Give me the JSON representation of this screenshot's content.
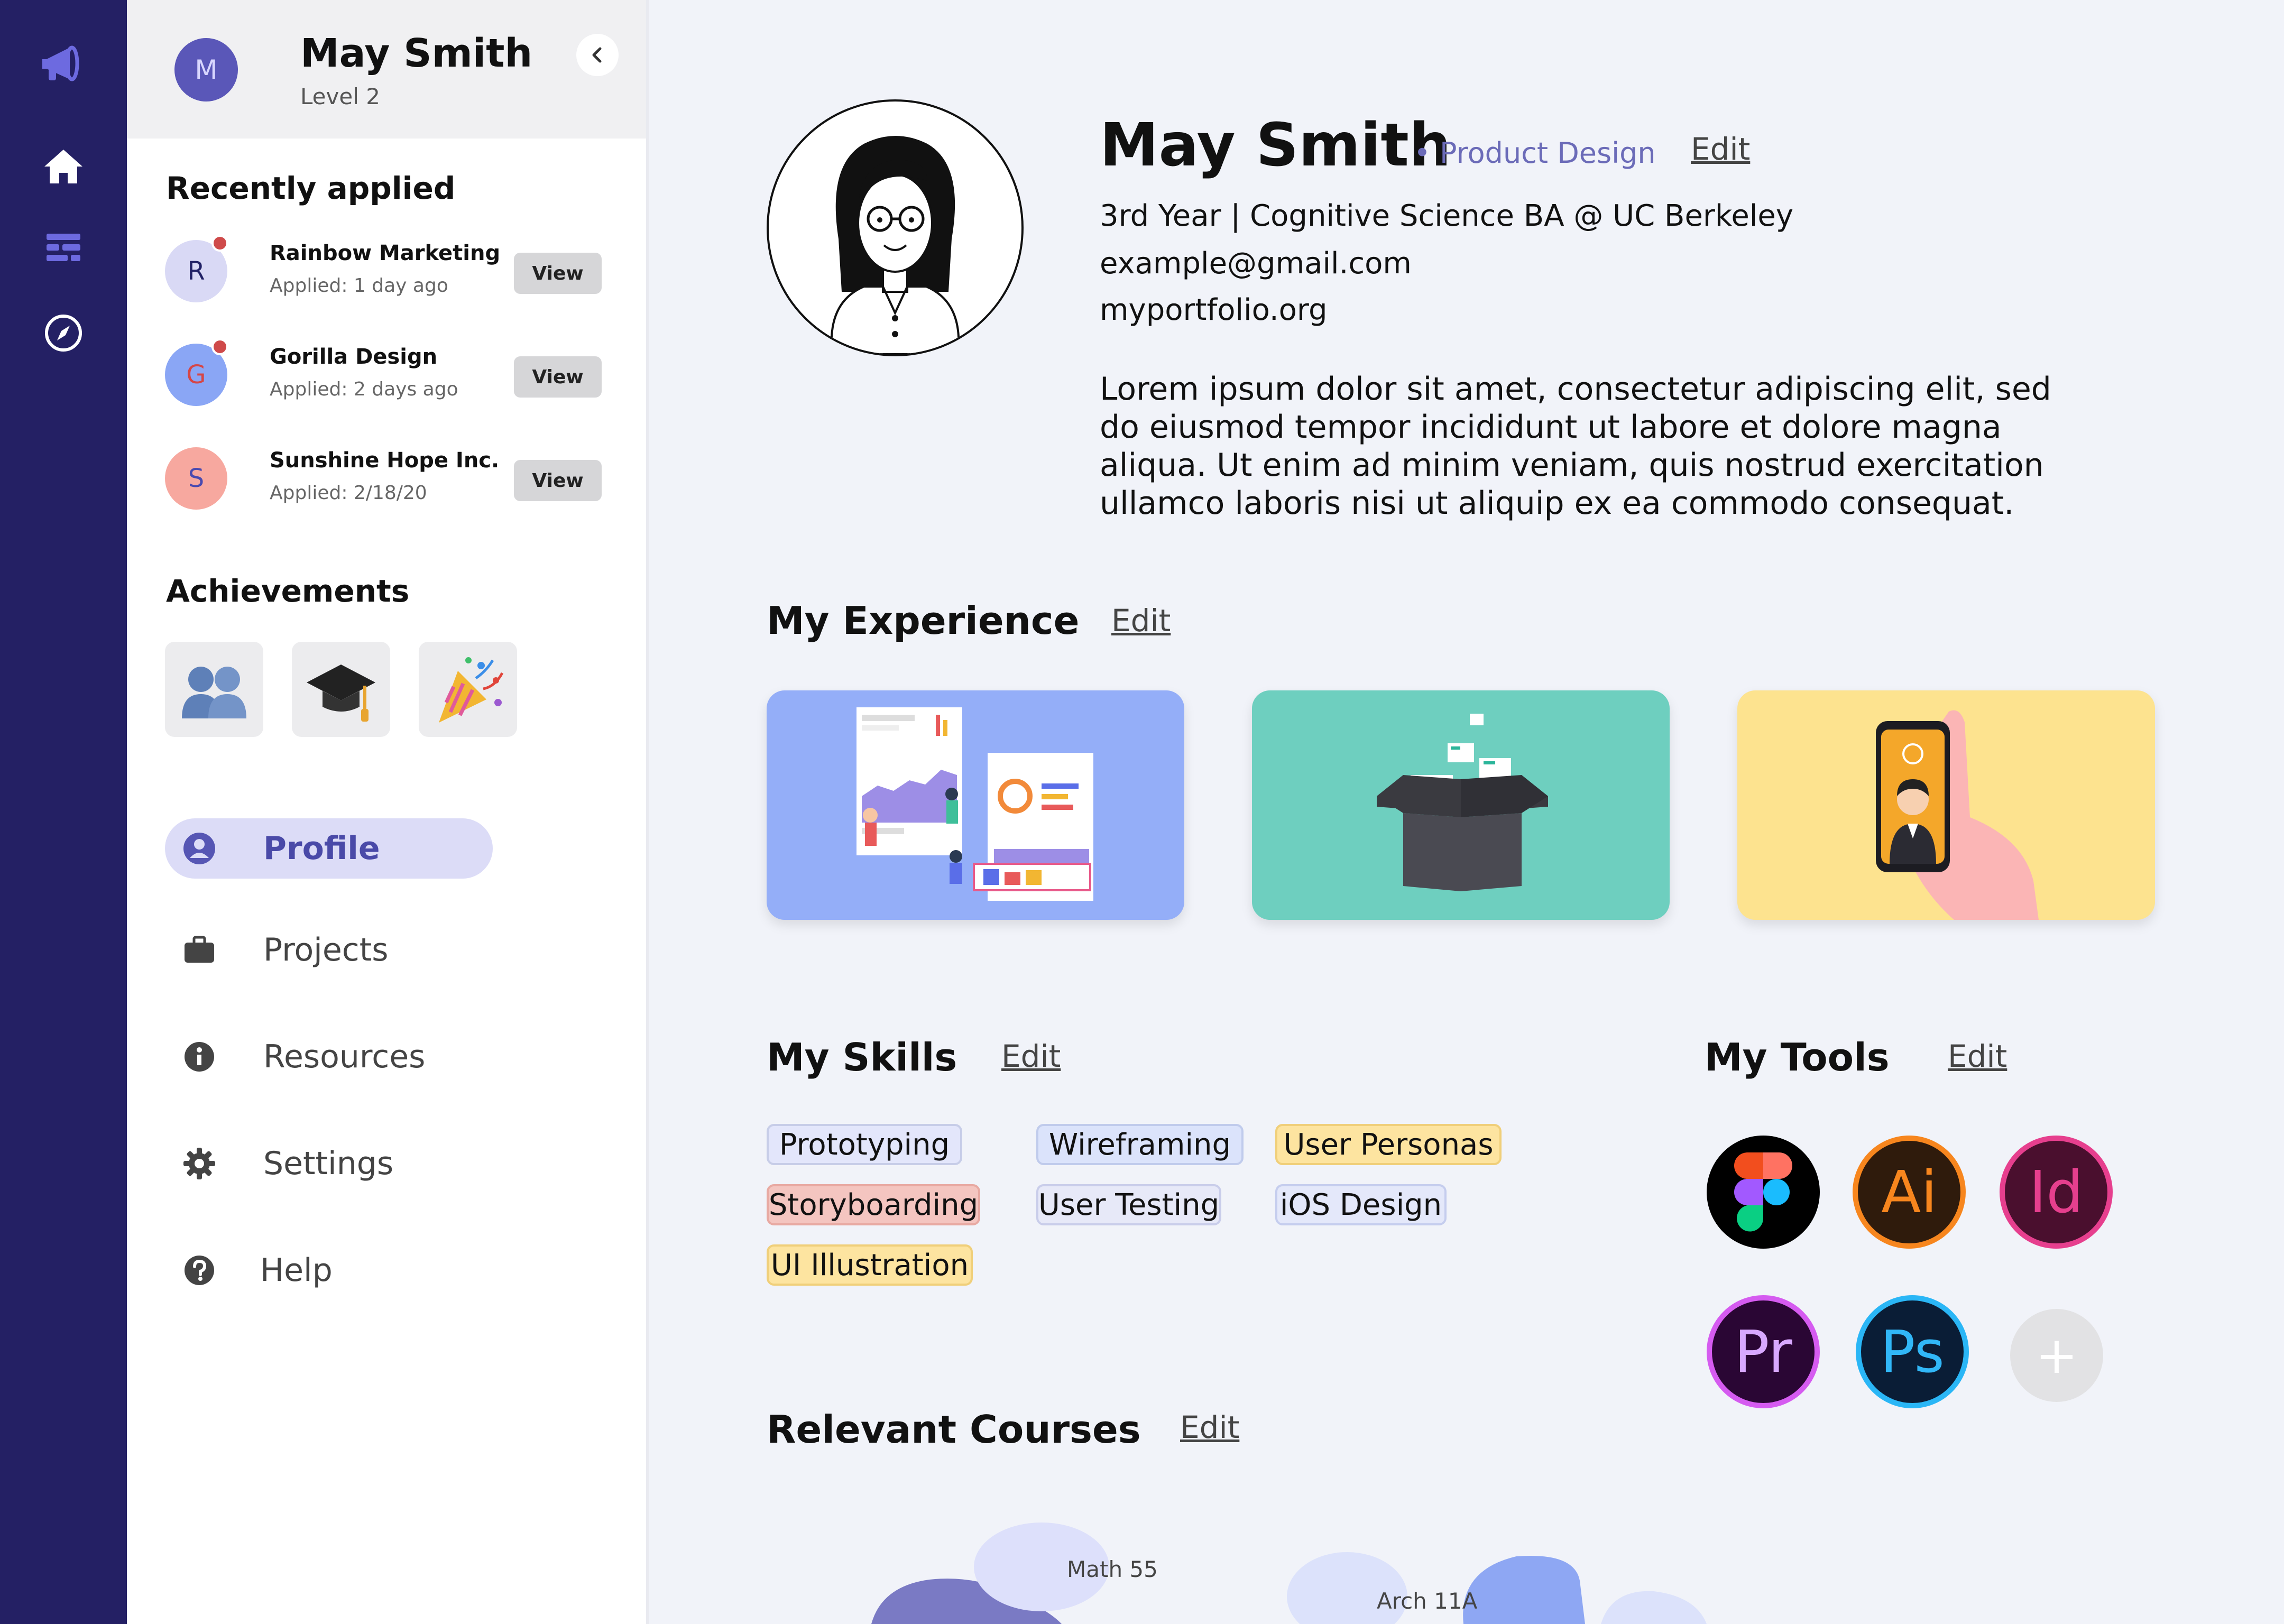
{
  "user": {
    "initial": "M",
    "name": "May Smith",
    "level": "Level 2"
  },
  "rail": {
    "icons": [
      "megaphone-icon",
      "home-icon",
      "dashboard-icon",
      "compass-icon"
    ]
  },
  "recently_applied": {
    "title": "Recently applied",
    "items": [
      {
        "initial": "R",
        "company": "Rainbow Marketing",
        "applied": "Applied: 1 day ago",
        "view": "View",
        "avatar_bg": "#d9d9f5",
        "avatar_fg": "#222266",
        "unread": true
      },
      {
        "initial": "G",
        "company": "Gorilla Design",
        "applied": "Applied: 2 days ago",
        "view": "View",
        "avatar_bg": "#8aa6f5",
        "avatar_fg": "#d64545",
        "unread": true
      },
      {
        "initial": "S",
        "company": "Sunshine Hope Inc.",
        "applied": "Applied: 2/18/20",
        "view": "View",
        "avatar_bg": "#f7a89f",
        "avatar_fg": "#4a4ab0",
        "unread": false
      }
    ]
  },
  "achievements": {
    "title": "Achievements",
    "items": [
      "people-badge-icon",
      "graduation-cap-icon",
      "party-popper-icon"
    ]
  },
  "nav": {
    "items": [
      {
        "label": "Profile",
        "icon": "user-circle-icon",
        "active": true
      },
      {
        "label": "Projects",
        "icon": "briefcase-icon",
        "active": false
      },
      {
        "label": "Resources",
        "icon": "info-icon",
        "active": false
      },
      {
        "label": "Settings",
        "icon": "gear-icon",
        "active": false
      },
      {
        "label": "Help",
        "icon": "help-icon",
        "active": false
      }
    ]
  },
  "profile": {
    "name": "May Smith",
    "department": "• Product Design",
    "edit": "Edit",
    "education": "3rd Year | Cognitive Science BA @ UC Berkeley",
    "email": "example@gmail.com",
    "website": "myportfolio.org",
    "bio": "Lorem ipsum dolor sit amet, consectetur adipiscing elit, sed do eiusmod tempor incididunt ut labore et dolore magna aliqua. Ut enim ad minim veniam, quis nostrud exercitation ullamco laboris nisi ut aliquip ex ea commodo consequat."
  },
  "experience": {
    "title": "My Experience",
    "edit": "Edit",
    "cards": [
      {
        "icon": "analytics-illustration-icon",
        "bg": "#94aef8"
      },
      {
        "icon": "open-box-illustration-icon",
        "bg": "#6ecfbf"
      },
      {
        "icon": "phone-selfie-illustration-icon",
        "bg": "#fde38f"
      }
    ]
  },
  "skills": {
    "title": "My Skills",
    "edit": "Edit",
    "items": [
      {
        "label": "Prototyping",
        "bg": "#e3e6fb",
        "border": "#c7cde8"
      },
      {
        "label": "Wireframing",
        "bg": "#dbe3fb",
        "border": "#c0cbec"
      },
      {
        "label": "User Personas",
        "bg": "#fde4a0",
        "border": "#f0cf7a"
      },
      {
        "label": "Storyboarding",
        "bg": "#f4c5c0",
        "border": "#e8a9a2"
      },
      {
        "label": "User Testing",
        "bg": "#e7e9f8",
        "border": "#c9cdea"
      },
      {
        "label": "iOS Design",
        "bg": "#e4e8fa",
        "border": "#c5cdee"
      },
      {
        "label": "UI Illustration",
        "bg": "#fde4a0",
        "border": "#f0cf7a"
      }
    ]
  },
  "tools": {
    "title": "My Tools",
    "edit": "Edit",
    "items": [
      {
        "icon": "figma-icon",
        "label": "",
        "bg": "#000000",
        "ring": "#000000",
        "fg": "#ffffff"
      },
      {
        "icon": "illustrator-icon",
        "label": "Ai",
        "bg": "#2f1b0c",
        "ring": "#f7861e",
        "fg": "#f7861e"
      },
      {
        "icon": "indesign-icon",
        "label": "Id",
        "bg": "#4a0f2e",
        "ring": "#e63f8e",
        "fg": "#e63f8e"
      },
      {
        "icon": "premiere-icon",
        "label": "Pr",
        "bg": "#2a0634",
        "ring": "#d55bf0",
        "fg": "#d8a8ff"
      },
      {
        "icon": "photoshop-icon",
        "label": "Ps",
        "bg": "#0a1d36",
        "ring": "#2ab6f6",
        "fg": "#31b7f7"
      },
      {
        "icon": "plus-icon",
        "label": "+",
        "bg": "#e2e2e4",
        "ring": "#e2e2e4",
        "fg": "#ffffff"
      }
    ]
  },
  "courses": {
    "title": "Relevant Courses",
    "edit": "Edit",
    "items": [
      "Math 55",
      "Arch 11A"
    ]
  }
}
